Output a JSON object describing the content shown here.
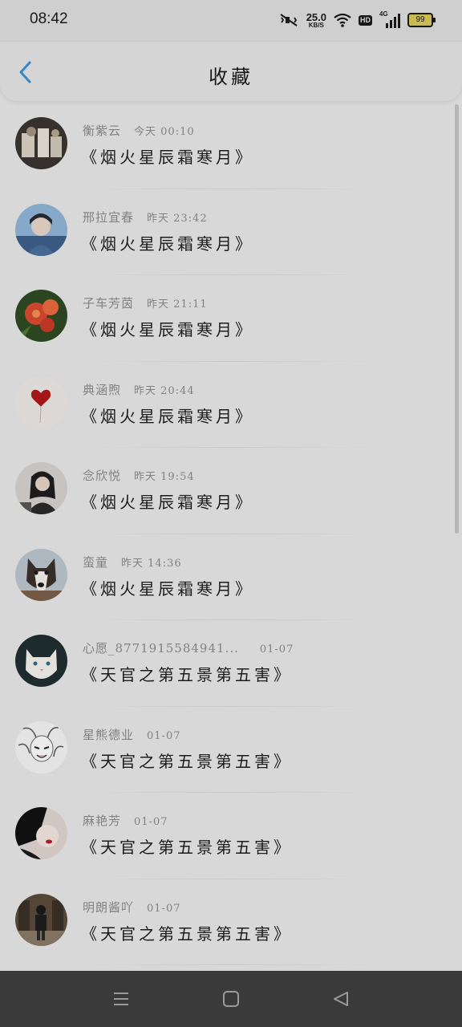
{
  "status_bar": {
    "time": "08:42",
    "speed_value": "25.0",
    "speed_unit": "KB/S",
    "hd_label": "HD",
    "network_label": "4G",
    "battery": "99"
  },
  "header": {
    "title": "收藏",
    "back_icon": "chevron-left-icon",
    "accent": "#3a8fd0"
  },
  "favorites": [
    {
      "user": "衡紫云",
      "time": "今天 00:10",
      "book": "《烟火星辰霜寒月》"
    },
    {
      "user": "邢拉宜春",
      "time": "昨天 23:42",
      "book": "《烟火星辰霜寒月》"
    },
    {
      "user": "子车芳茵",
      "time": "昨天 21:11",
      "book": "《烟火星辰霜寒月》"
    },
    {
      "user": "典涵煦",
      "time": "昨天 20:44",
      "book": "《烟火星辰霜寒月》"
    },
    {
      "user": "念欣悦",
      "time": "昨天 19:54",
      "book": "《烟火星辰霜寒月》"
    },
    {
      "user": "蛮童",
      "time": "昨天 14:36",
      "book": "《烟火星辰霜寒月》"
    },
    {
      "user": "心愿_8771915584941...",
      "time": "01-07",
      "book": "《天官之第五景第五害》"
    },
    {
      "user": "星熊德业",
      "time": "01-07",
      "book": "《天官之第五景第五害》"
    },
    {
      "user": "麻艳芳",
      "time": "01-07",
      "book": "《天官之第五景第五害》"
    },
    {
      "user": "明朗酱吖",
      "time": "01-07",
      "book": "《天官之第五景第五害》"
    }
  ],
  "nav_bar": {
    "menu_icon": "menu-icon",
    "home_icon": "home-icon",
    "back_icon": "back-triangle-icon"
  }
}
